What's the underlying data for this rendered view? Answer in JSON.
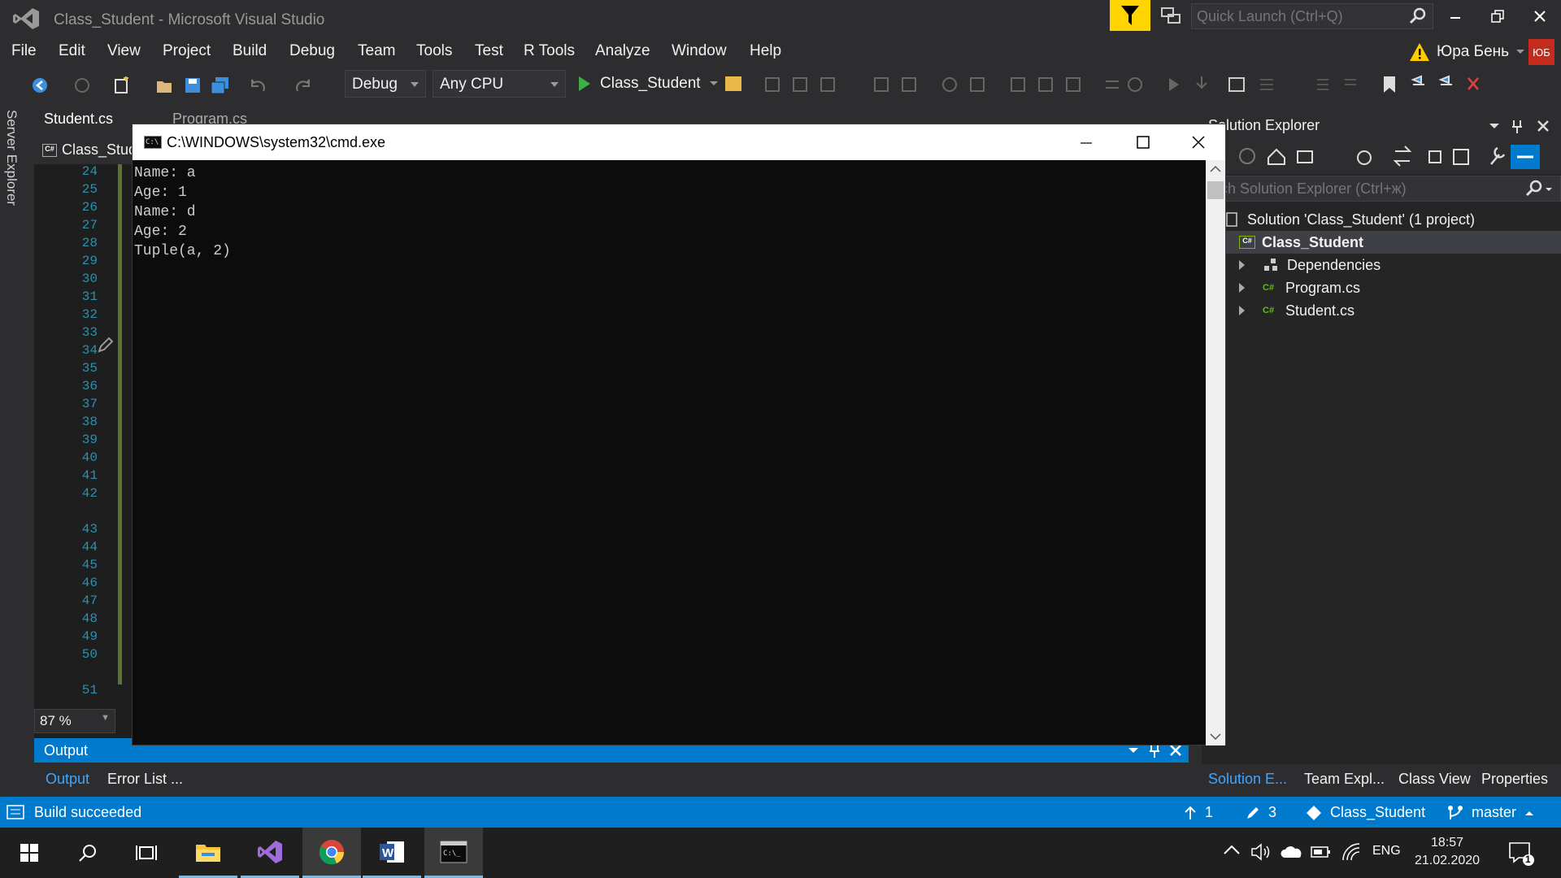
{
  "window": {
    "title": "Class_Student - Microsoft Visual Studio"
  },
  "quick_launch": {
    "placeholder": "Quick Launch (Ctrl+Q)"
  },
  "menu": [
    "File",
    "Edit",
    "View",
    "Project",
    "Build",
    "Debug",
    "Team",
    "Tools",
    "Test",
    "R Tools",
    "Analyze",
    "Window",
    "Help"
  ],
  "user": {
    "name": "Юра Бень",
    "initials": "ЮБ",
    "warning_icon": "warning-icon"
  },
  "toolbar": {
    "configuration": "Debug",
    "platform": "Any CPU",
    "startup_project": "Class_Student"
  },
  "side_tabs": {
    "server_explorer": "Server Explorer"
  },
  "doc_tabs": [
    {
      "label": "Student.cs"
    },
    {
      "label": "Program.cs"
    }
  ],
  "editor": {
    "nav_project": "Class_Stud",
    "line_numbers": [
      "24",
      "25",
      "26",
      "27",
      "28",
      "29",
      "30",
      "31",
      "32",
      "33",
      "34",
      "35",
      "36",
      "37",
      "38",
      "39",
      "40",
      "41",
      "42",
      "43",
      "44",
      "45",
      "46",
      "47",
      "48",
      "49",
      "50",
      "51"
    ],
    "zoom": "87 %"
  },
  "console": {
    "title": "C:\\WINDOWS\\system32\\cmd.exe",
    "lines": [
      "Name: a",
      "Age: 1",
      "Name: d",
      "Age: 2",
      "Tuple(a, 2)"
    ]
  },
  "solution_explorer": {
    "title": "Solution Explorer",
    "search_placeholder": "arch Solution Explorer (Ctrl+ж)",
    "solution": "Solution 'Class_Student' (1 project)",
    "project": "Class_Student",
    "items": [
      "Dependencies",
      "Program.cs",
      "Student.cs"
    ],
    "bottom_tabs": [
      "Solution E...",
      "Team Expl...",
      "Class View",
      "Properties"
    ]
  },
  "output": {
    "title": "Output",
    "tabs": [
      "Output",
      "Error List ..."
    ]
  },
  "status": {
    "text": "Build succeeded",
    "pushes": "1",
    "changes": "3",
    "repo": "Class_Student",
    "branch": "master"
  },
  "taskbar": {
    "apps": [
      "windows-start-icon",
      "search-icon",
      "task-view-icon",
      "file-explorer-icon",
      "visual-studio-icon",
      "chrome-icon",
      "word-icon",
      "cmd-icon"
    ],
    "language": "ENG",
    "time": "18:57",
    "date": "21.02.2020",
    "notifications": "1"
  },
  "colors": {
    "accent": "#007acc",
    "filter": "#ffd400",
    "avatar": "#c42b1c"
  }
}
